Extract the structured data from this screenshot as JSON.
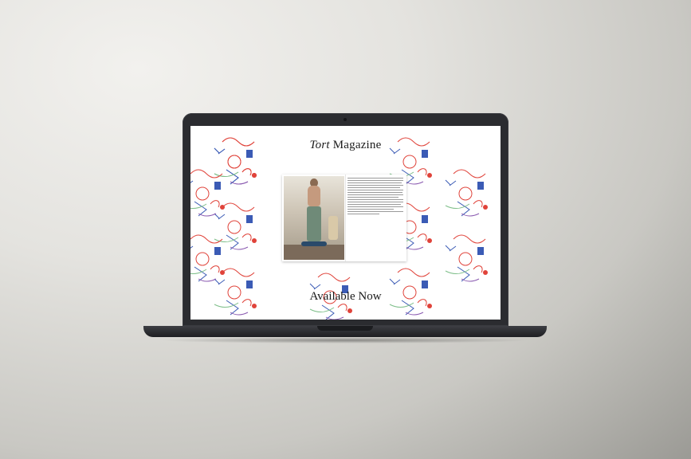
{
  "site": {
    "title_italic": "Tort",
    "title_rest": " Magazine",
    "cta": "Available Now"
  },
  "colors": {
    "background": "#dcdbd7",
    "screen_bg": "#ffffff",
    "laptop_body": "#2b2c30",
    "pattern_red": "#e0433a",
    "pattern_blue": "#3b5bb5",
    "pattern_green": "#7fbf8a"
  },
  "icons": [
    "camera-icon"
  ]
}
